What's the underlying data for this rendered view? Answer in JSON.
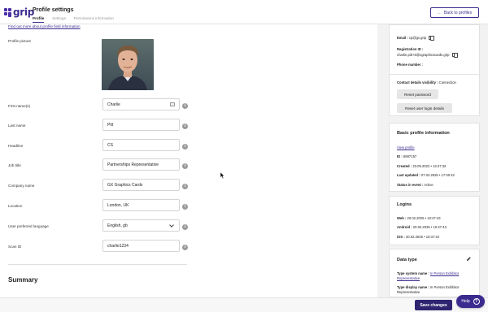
{
  "header": {
    "logo": "grip",
    "title": "Profile settings",
    "tabs": [
      {
        "label": "Profile",
        "active": true
      },
      {
        "label": "Settings",
        "active": false
      },
      {
        "label": "Permissions information",
        "active": false
      }
    ],
    "back_label": "Back to profiles"
  },
  "main": {
    "find_link": "Find out more about profile field information",
    "profile_picture_label": "Profile picture",
    "fields": {
      "first_name": {
        "label": "First name(s)",
        "value": "Charlie"
      },
      "last_name": {
        "label": "Last name",
        "value": "Pitt"
      },
      "headline": {
        "label": "Headline",
        "value": "CS"
      },
      "job_title": {
        "label": "Job title",
        "value": "Partnerships Representative"
      },
      "company": {
        "label": "Company name",
        "value": "GX Graphics Cards"
      },
      "location": {
        "label": "Location",
        "value": "London, UK"
      },
      "language": {
        "label": "User preferred language",
        "value": "English, gb"
      },
      "scan_id": {
        "label": "Scan ID",
        "value": "charlie1234"
      }
    },
    "summary_heading": "Summary"
  },
  "contact": {
    "email_label": "Email :",
    "email_value": "cp@gx.grip",
    "registration_label": "Registration ID :",
    "registration_value": "charlie.pitt+5@xgraphicscards.grip",
    "phone_label": "Phone number :",
    "visibility_label": "Contact details visibility :",
    "visibility_value": "Connection",
    "reset_password": "Reset password",
    "reset_login": "Reset user login details"
  },
  "basic": {
    "title": "Basic profile information",
    "view_profile": "View profile",
    "id_label": "ID :",
    "id_value": "6887157",
    "created_label": "Created :",
    "created_value": "23.09.2022 • 13:47:32",
    "updated_label": "Last updated :",
    "updated_value": "07.02.2025 • 17:00:42",
    "status_label": "Status in event :",
    "status_value": "Active"
  },
  "logins": {
    "title": "Logins",
    "web_label": "Web :",
    "web_value": "20.02.2025 • 10:47:43",
    "android_label": "Android :",
    "android_value": "20.02.2025 • 10:47:43",
    "ios_label": "iOS :",
    "ios_value": "20.02.2025 • 10:47:43"
  },
  "data_type": {
    "title": "Data type",
    "system_label": "Type system name :",
    "system_value": "In Person Exhibitor Representative",
    "display_label": "Type display name :",
    "display_value": "In Person Exhibitor Representative"
  },
  "footer": {
    "save_label": "Save changes",
    "help_label": "Help",
    "help_icon": "?"
  },
  "colors": {
    "brand": "#3c2b8f",
    "save": "#2f2470"
  }
}
